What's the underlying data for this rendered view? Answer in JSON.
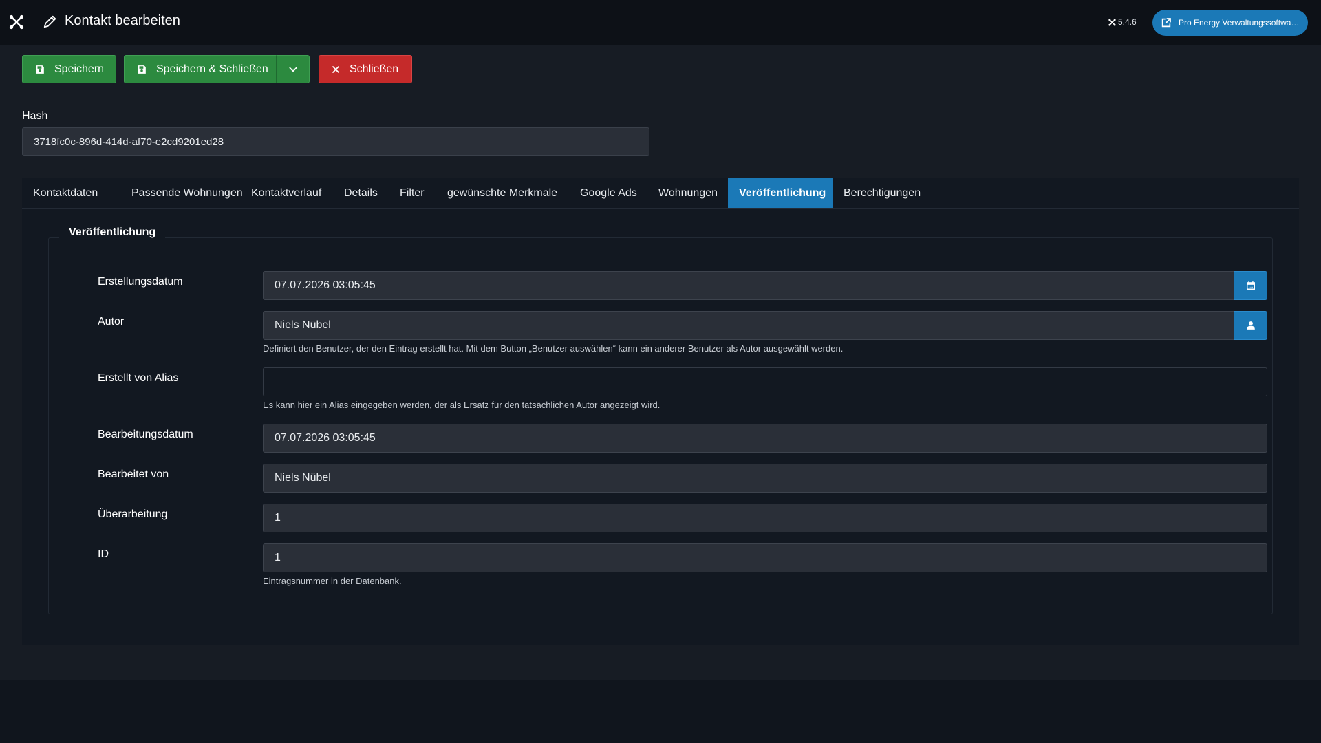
{
  "header": {
    "title": "Kontakt bearbeiten",
    "version": "5.4.6",
    "site_button_label": "Pro Energy Verwaltungssoftwa…"
  },
  "toolbar": {
    "save_label": "Speichern",
    "save_close_label": "Speichern & Schließen",
    "close_label": "Schließen"
  },
  "hash": {
    "label": "Hash",
    "value": "3718fc0c-896d-414d-af70-e2cd9201ed28"
  },
  "tabs": [
    {
      "label": "Kontaktdaten",
      "active": false
    },
    {
      "label": "Passende Wohnungen",
      "active": false
    },
    {
      "label": "Kontaktverlauf",
      "active": false
    },
    {
      "label": "Details",
      "active": false
    },
    {
      "label": "Filter",
      "active": false
    },
    {
      "label": "gewünschte Merkmale",
      "active": false
    },
    {
      "label": "Google Ads",
      "active": false
    },
    {
      "label": "Wohnungen",
      "active": false
    },
    {
      "label": "Veröffentlichung",
      "active": true
    },
    {
      "label": "Berechtigungen",
      "active": false
    }
  ],
  "publishing": {
    "legend": "Veröffentlichung",
    "fields": [
      {
        "label": "Erstellungsdatum",
        "value": "07.07.2026 03:05:45",
        "addon_icon": "calendar-icon"
      },
      {
        "label": "Autor",
        "value": "Niels Nübel",
        "addon_icon": "user-icon",
        "help": "Definiert den Benutzer, der den Eintrag erstellt hat. Mit dem Button „Benutzer auswählen“ kann ein anderer Benutzer als Autor ausgewählt werden."
      },
      {
        "label": "Erstellt von Alias",
        "value": "",
        "help": "Es kann hier ein Alias eingegeben werden, der als Ersatz für den tatsächlichen Autor angezeigt wird."
      },
      {
        "label": "Bearbeitungsdatum",
        "value": "07.07.2026 03:05:45"
      },
      {
        "label": "Bearbeitet von",
        "value": "Niels Nübel"
      },
      {
        "label": "Überarbeitung",
        "value": "1"
      },
      {
        "label": "ID",
        "value": "1",
        "help": "Eintragsnummer in der Datenbank."
      }
    ]
  },
  "colors": {
    "accent_blue": "#1b79b7",
    "success_green": "#2c8a3f",
    "danger_red": "#c52a2a"
  }
}
